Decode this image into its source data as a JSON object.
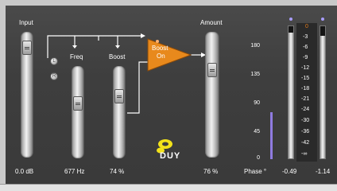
{
  "plugin": {
    "labels": {
      "input": "Input",
      "freq": "Freq",
      "boost": "Boost",
      "amount": "Amount",
      "phase": "Phase °"
    },
    "values": {
      "input": "0.0 dB",
      "freq": "677 Hz",
      "boost": "74 %",
      "amount": "76 %",
      "meter_left": "-0.49",
      "meter_right": "-1.14"
    },
    "boost_button": {
      "line1": "Boost",
      "line2": "On"
    },
    "radio_options": [
      {
        "label": "L"
      },
      {
        "label": "R"
      }
    ],
    "phase_scale": [
      "180",
      "135",
      "90",
      "45",
      "0"
    ],
    "db_scale": [
      "0",
      "-3",
      "-6",
      "-9",
      "-12",
      "-15",
      "-18",
      "-21",
      "-24",
      "-30",
      "-36",
      "-42",
      "-∞"
    ],
    "levels": {
      "input": 0.0,
      "freq": 0.35,
      "boost": 0.55,
      "amount": 0.76,
      "phase_degrees": 60,
      "meter_left_db": -0.49,
      "meter_right_db": -1.14
    },
    "logo": "DUY",
    "colors": {
      "panel": "#3e3e3e",
      "boost_button": "#e8891c",
      "phase_bar": "#8f7be0",
      "scale_zero": "#e07a1c"
    }
  }
}
